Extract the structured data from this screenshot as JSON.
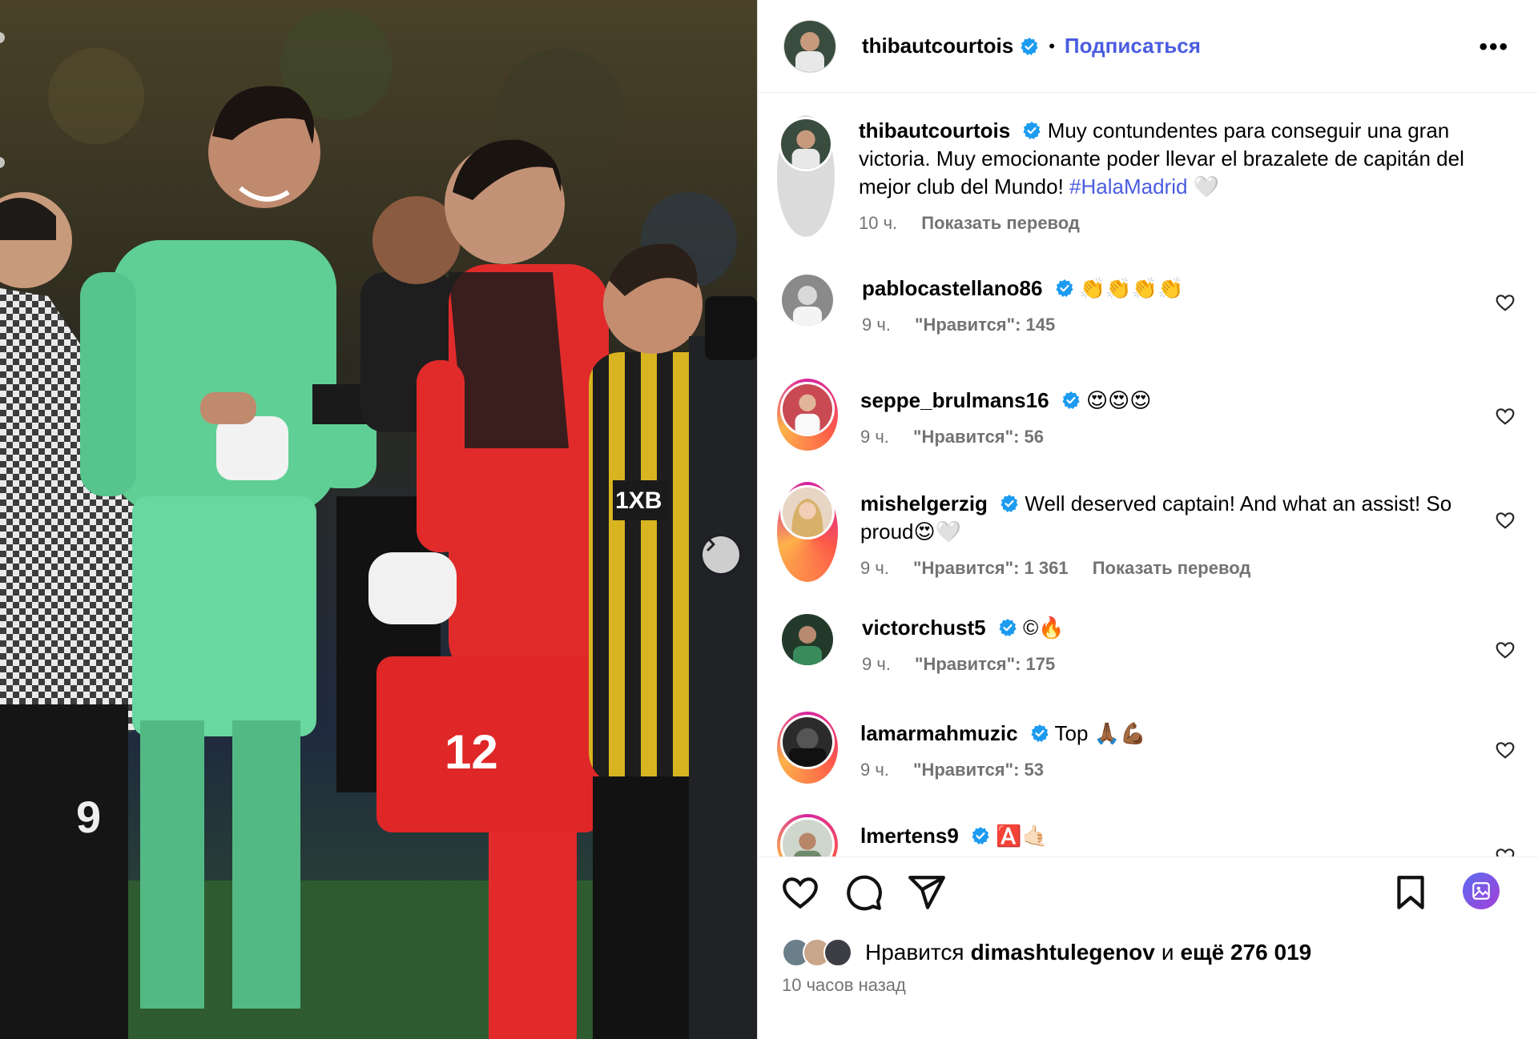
{
  "post": {
    "username": "thibautcourtois",
    "follow_label": "Подписаться",
    "dot": "•",
    "more_label": "•••"
  },
  "caption": {
    "username": "thibautcourtois",
    "text": "Muy contundentes para conseguir una gran victoria. Muy emocionante poder llevar el brazalete de capitán del mejor club del Mundo!",
    "hashtag": "#HalaMadrid",
    "emoji": "🤍",
    "time": "10 ч.",
    "translate": "Показать перевод"
  },
  "comments": [
    {
      "username": "pablocastellano86",
      "text": "👏👏👏👏",
      "time": "9 ч.",
      "likes": "\"Нравится\": 145",
      "translate": ""
    },
    {
      "username": "seppe_brulmans16",
      "text": "😍😍😍",
      "time": "9 ч.",
      "likes": "\"Нравится\": 56",
      "translate": ""
    },
    {
      "username": "mishelgerzig",
      "text": "Well deserved captain! And what an assist! So proud😍🤍",
      "time": "9 ч.",
      "likes": "\"Нравится\": 1 361",
      "translate": "Показать перевод"
    },
    {
      "username": "victorchust5",
      "text": "©🔥",
      "time": "9 ч.",
      "likes": "\"Нравится\": 175",
      "translate": ""
    },
    {
      "username": "lamarmahmuzic",
      "text": "Top 🙏🏾💪🏾",
      "time": "9 ч.",
      "likes": "\"Нравится\": 53",
      "translate": ""
    },
    {
      "username": "lmertens9",
      "text": "🅰️🤙🏻",
      "time": "",
      "likes": "",
      "translate": ""
    }
  ],
  "likes_bar": {
    "prefix": "Нравится",
    "user": "dimashtulegenov",
    "middle": "и",
    "rest": "ещё 276 019"
  },
  "posted_time": "10 часов назад",
  "colors": {
    "accent": "#4a5ce0",
    "meta": "#737373",
    "verified": "#1d9bf0"
  },
  "icons": [
    "heart-icon",
    "comment-icon",
    "share-icon",
    "bookmark-icon",
    "gallery-icon",
    "verified-icon",
    "more-icon",
    "chevron-right-icon",
    "download-icon"
  ]
}
